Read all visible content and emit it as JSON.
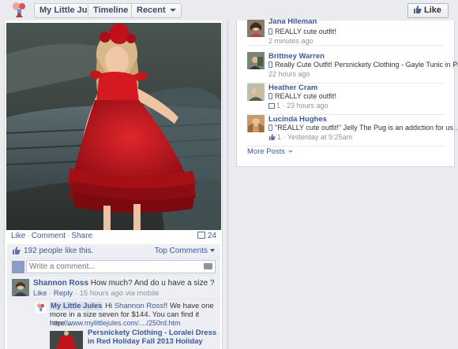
{
  "topbar": {
    "page_name": "My Little Jules",
    "timeline_label": "Timeline",
    "recent_label": "Recent",
    "like_label": "Like"
  },
  "post": {
    "actions": {
      "like": "Like",
      "comment": "Comment",
      "share": "Share",
      "sep": "·"
    },
    "comment_count": "24",
    "likes_text": "192 people like this.",
    "top_comments_label": "Top Comments",
    "comment_placeholder": "Write a comment...",
    "comments": [
      {
        "name": "Shannon Ross",
        "text": " How much? And do u have a size ?",
        "like": "Like",
        "reply": "Reply",
        "meta": " · 15 hours ago via mobile"
      }
    ],
    "reply": {
      "name": "My Little Jules",
      "text_before": " Hi ",
      "mention": "Shannon Ross",
      "text_after": "!! We have one more in a size seven for $144. You can find it here....",
      "link": "http://www.mylittlejules.com/..../250rd.htm",
      "shared_title": "Persnickety Clothing - Loralei Dress in Red Holiday Fall 2013 Holiday"
    }
  },
  "feed": {
    "items": [
      {
        "name": "Jana Hileman",
        "text": "REALLY cute outfit!",
        "meta": "2 minutes ago",
        "comments": ""
      },
      {
        "name": "Brittney Warren",
        "text": "Really Cute Outfit! Persnickety Clothing - Gayle Tunic in Pi...",
        "meta": "22 hours ago",
        "comments": ""
      },
      {
        "name": "Heather Cram",
        "text": "REALLY cute outfit!",
        "meta": " · 23 hours ago",
        "comments": "1"
      },
      {
        "name": "Lucinda Hughes",
        "text": "\"REALLY cute outfit!\" Jelly The Pug is an addiction for us ...",
        "meta": " · Yesterday at 9:25am",
        "comments": "1"
      }
    ],
    "more_posts": "More Posts"
  },
  "colors": {
    "link": "#3b5998",
    "accent_bg": "#edeff4",
    "dress": "#c0141c"
  }
}
